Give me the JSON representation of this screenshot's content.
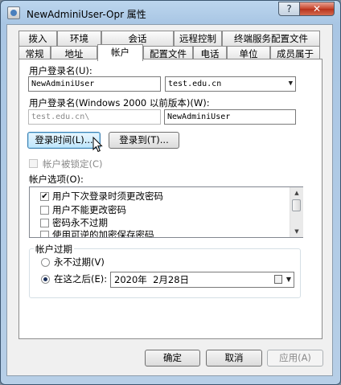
{
  "window": {
    "title": "NewAdminiUser-Opr 属性",
    "help_glyph": "?",
    "close_glyph": "✕"
  },
  "tabs": {
    "row1": [
      "拨入",
      "环境",
      "会话",
      "远程控制",
      "终端服务配置文件"
    ],
    "row2": [
      "常规",
      "地址",
      "帐户",
      "配置文件",
      "电话",
      "单位",
      "成员属于"
    ],
    "active": "帐户"
  },
  "account": {
    "logon_name_label": "用户登录名(U):",
    "logon_name_value": "NewAdminiUser",
    "domain_suffix": "test.edu.cn",
    "pre2000_label": "用户登录名(Windows 2000 以前版本)(W):",
    "pre2000_domain": "test.edu.cn\\",
    "pre2000_name": "NewAdminiUser",
    "logon_hours_button": "登录时间(L)...",
    "logon_to_button": "登录到(T)...",
    "unlock_label": "帐户被锁定(C)",
    "options_label": "帐户选项(O):",
    "options": [
      {
        "label": "用户下次登录时须更改密码",
        "checked": true
      },
      {
        "label": "用户不能更改密码",
        "checked": false
      },
      {
        "label": "密码永不过期",
        "checked": false
      },
      {
        "label": "使用可逆的加密保存密码",
        "checked": false
      }
    ],
    "expiry": {
      "group_label": "帐户过期",
      "never_label": "永不过期(V)",
      "end_of_label": "在这之后(E):",
      "date_value": "2020年  2月28日",
      "selected": "end_of"
    }
  },
  "footer": {
    "ok": "确定",
    "cancel": "取消",
    "apply": "应用(A)"
  }
}
